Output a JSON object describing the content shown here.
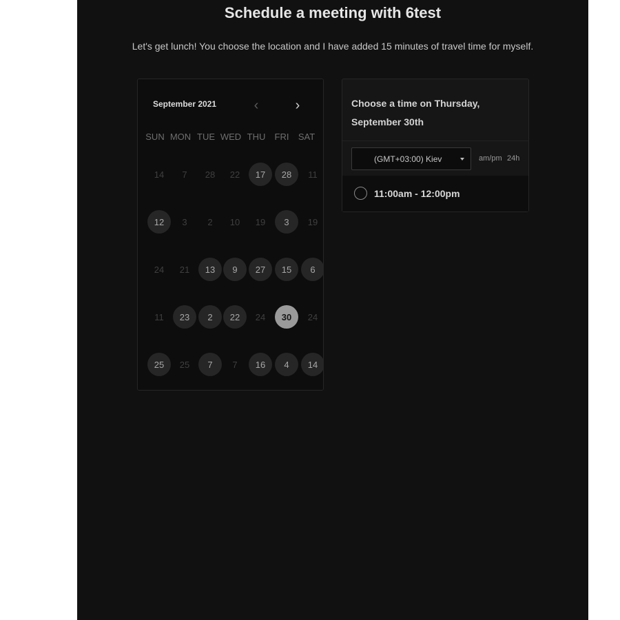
{
  "page": {
    "title": "Schedule a meeting with 6test",
    "subtitle": "Let's get lunch! You choose the location and I have added 15 minutes of travel time for myself."
  },
  "calendar": {
    "month": "September 2021",
    "prev_icon": "chevron-left-icon",
    "next_icon": "chevron-right-icon",
    "weekdays": [
      "SUN",
      "MON",
      "TUE",
      "WED",
      "THU",
      "FRI",
      "SAT"
    ],
    "weeks": [
      [
        {
          "d": "14",
          "s": "off"
        },
        {
          "d": "7",
          "s": "off"
        },
        {
          "d": "28",
          "s": "off"
        },
        {
          "d": "22",
          "s": "off"
        },
        {
          "d": "17",
          "s": "on"
        },
        {
          "d": "28",
          "s": "on"
        },
        {
          "d": "11",
          "s": "off"
        }
      ],
      [
        {
          "d": "12",
          "s": "on"
        },
        {
          "d": "3",
          "s": "off"
        },
        {
          "d": "2",
          "s": "off"
        },
        {
          "d": "10",
          "s": "off"
        },
        {
          "d": "19",
          "s": "off"
        },
        {
          "d": "3",
          "s": "on"
        },
        {
          "d": "19",
          "s": "off"
        }
      ],
      [
        {
          "d": "24",
          "s": "off"
        },
        {
          "d": "21",
          "s": "off"
        },
        {
          "d": "13",
          "s": "on"
        },
        {
          "d": "9",
          "s": "on"
        },
        {
          "d": "27",
          "s": "on"
        },
        {
          "d": "15",
          "s": "on"
        },
        {
          "d": "6",
          "s": "on"
        }
      ],
      [
        {
          "d": "11",
          "s": "off"
        },
        {
          "d": "23",
          "s": "on"
        },
        {
          "d": "2",
          "s": "on"
        },
        {
          "d": "22",
          "s": "on"
        },
        {
          "d": "24",
          "s": "off"
        },
        {
          "d": "30",
          "s": "sel"
        },
        {
          "d": "24",
          "s": "off"
        }
      ],
      [
        {
          "d": "25",
          "s": "on"
        },
        {
          "d": "25",
          "s": "off"
        },
        {
          "d": "7",
          "s": "on"
        },
        {
          "d": "7",
          "s": "off"
        },
        {
          "d": "16",
          "s": "on"
        },
        {
          "d": "4",
          "s": "on"
        },
        {
          "d": "14",
          "s": "on"
        }
      ]
    ]
  },
  "time_panel": {
    "heading": "Choose a time on Thursday, September 30th",
    "timezone": "(GMT+03:00) Kiev",
    "format_ampm": "am/pm",
    "format_24h": "24h",
    "slots": [
      "11:00am - 12:00pm"
    ]
  }
}
